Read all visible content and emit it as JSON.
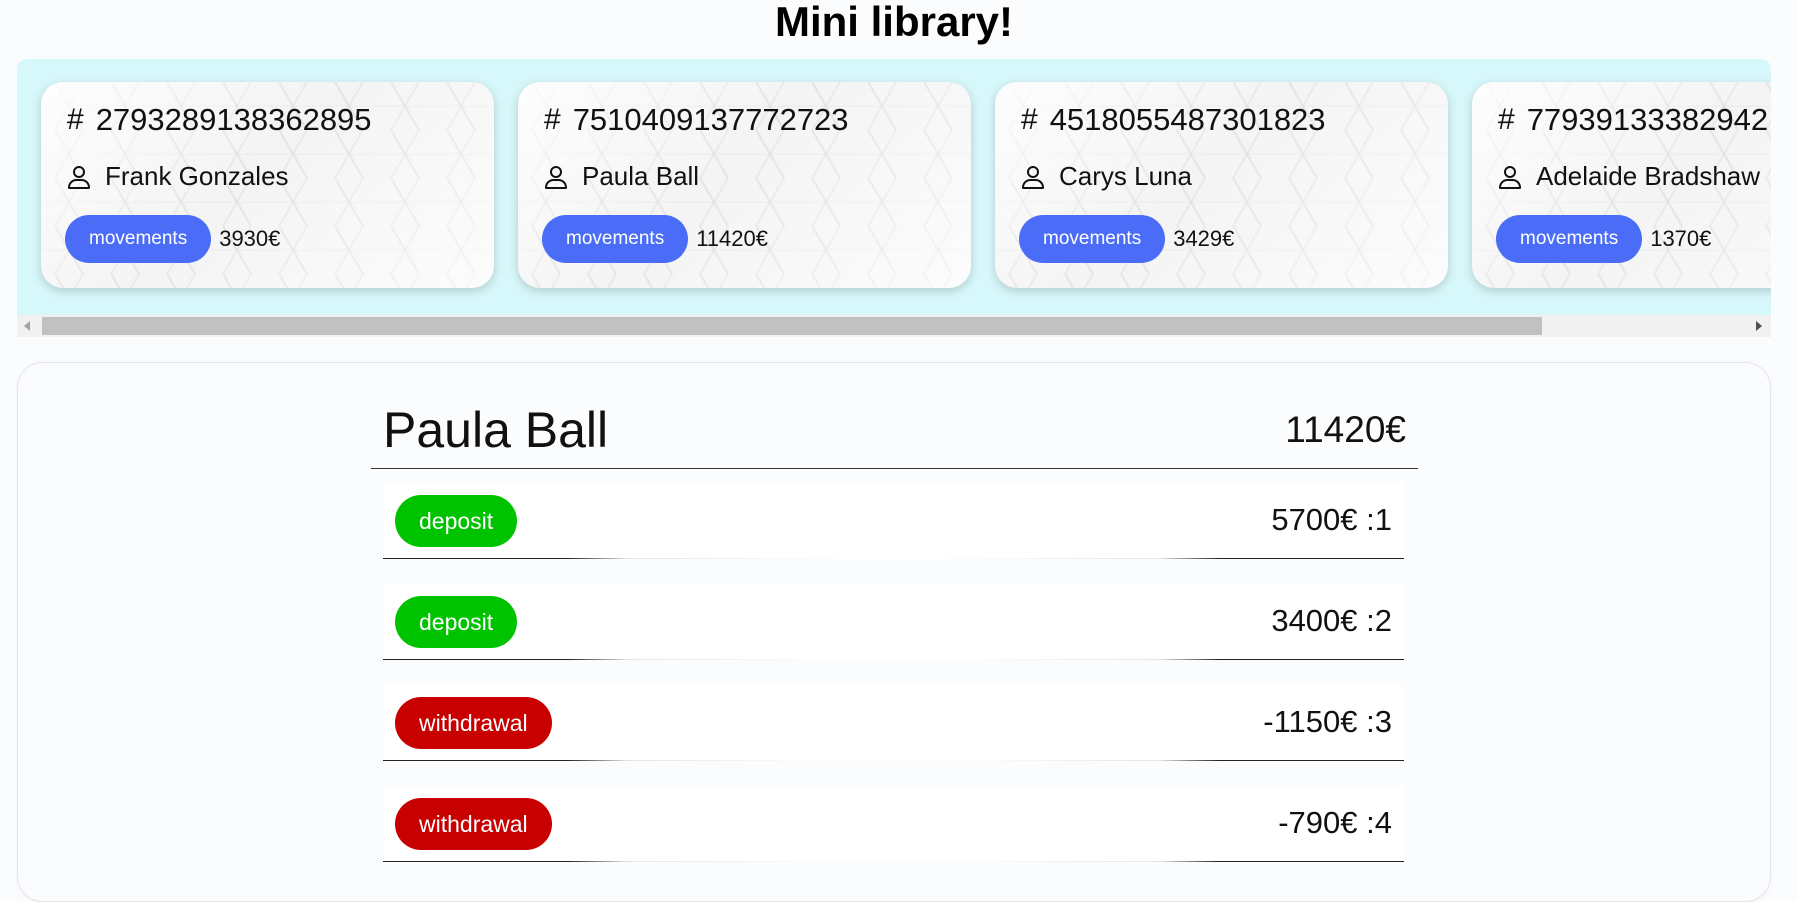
{
  "header": {
    "title": "Mini library!"
  },
  "accounts": [
    {
      "number": "2793289138362895",
      "owner": "Frank Gonzales",
      "button_label": "movements",
      "balance": "3930€"
    },
    {
      "number": "7510409137772723",
      "owner": "Paula Ball",
      "button_label": "movements",
      "balance": "11420€"
    },
    {
      "number": "4518055487301823",
      "owner": "Carys Luna",
      "button_label": "movements",
      "balance": "3429€"
    },
    {
      "number": "77939133382942",
      "owner": "Adelaide Bradshaw",
      "button_label": "movements",
      "balance": "1370€"
    }
  ],
  "icons": {
    "number": "hash-icon",
    "owner": "person-icon"
  },
  "colors": {
    "strip_background": "#d7f8fb",
    "movements_button": "#4a6cf7",
    "deposit": "#00c300",
    "withdrawal": "#c80000"
  },
  "scrollbar": {
    "visible_fraction": 0.88,
    "position_fraction": 0.0
  },
  "detail": {
    "owner": "Paula Ball",
    "balance": "11420€",
    "movements": [
      {
        "type": "deposit",
        "amount": "5700€ :1"
      },
      {
        "type": "deposit",
        "amount": "3400€ :2"
      },
      {
        "type": "withdrawal",
        "amount": "-1150€ :3"
      },
      {
        "type": "withdrawal",
        "amount": "-790€ :4"
      }
    ]
  }
}
